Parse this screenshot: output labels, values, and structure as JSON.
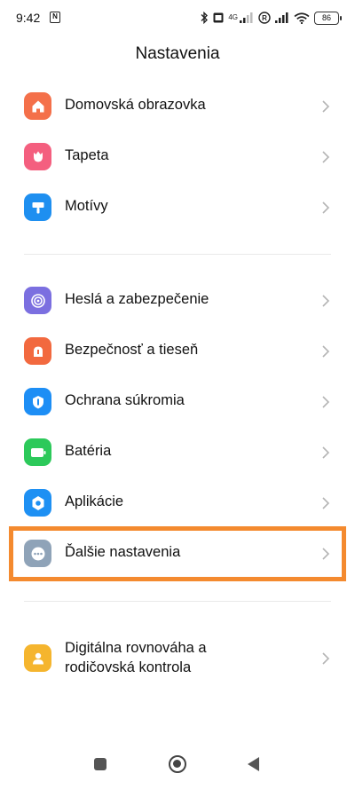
{
  "status_bar": {
    "time": "9:42",
    "nfc_glyph": "N",
    "network_label": "4G",
    "battery_level": "86"
  },
  "page_title": "Nastavenia",
  "groups": [
    {
      "items": [
        {
          "label": "Domovská obrazovka",
          "icon": "home-icon",
          "color": "#f4704a"
        },
        {
          "label": "Tapeta",
          "icon": "tulip-icon",
          "color": "#f45f7f"
        },
        {
          "label": "Motívy",
          "icon": "paint-roller-icon",
          "color": "#1e8ff0"
        }
      ]
    },
    {
      "items": [
        {
          "label": "Heslá a zabezpečenie",
          "icon": "fingerprint-icon",
          "color": "#7b6fe0"
        },
        {
          "label": "Bezpečnosť a tieseň",
          "icon": "emergency-icon",
          "color": "#f2693f"
        },
        {
          "label": "Ochrana súkromia",
          "icon": "privacy-shield-icon",
          "color": "#1d8ef5"
        },
        {
          "label": "Batéria",
          "icon": "battery-icon",
          "color": "#2cc95a"
        },
        {
          "label": "Aplikácie",
          "icon": "gear-icon",
          "color": "#1e90f3"
        },
        {
          "label": "Ďalšie nastavenia",
          "icon": "more-dots-icon",
          "color": "#8fa3b8"
        }
      ]
    },
    {
      "items": [
        {
          "label_line1": "Digitálna rovnováha a",
          "label_line2": "rodičovská kontrola",
          "icon": "person-icon",
          "color": "#f5b52e"
        }
      ]
    }
  ],
  "highlight_color": "#f48a2f"
}
